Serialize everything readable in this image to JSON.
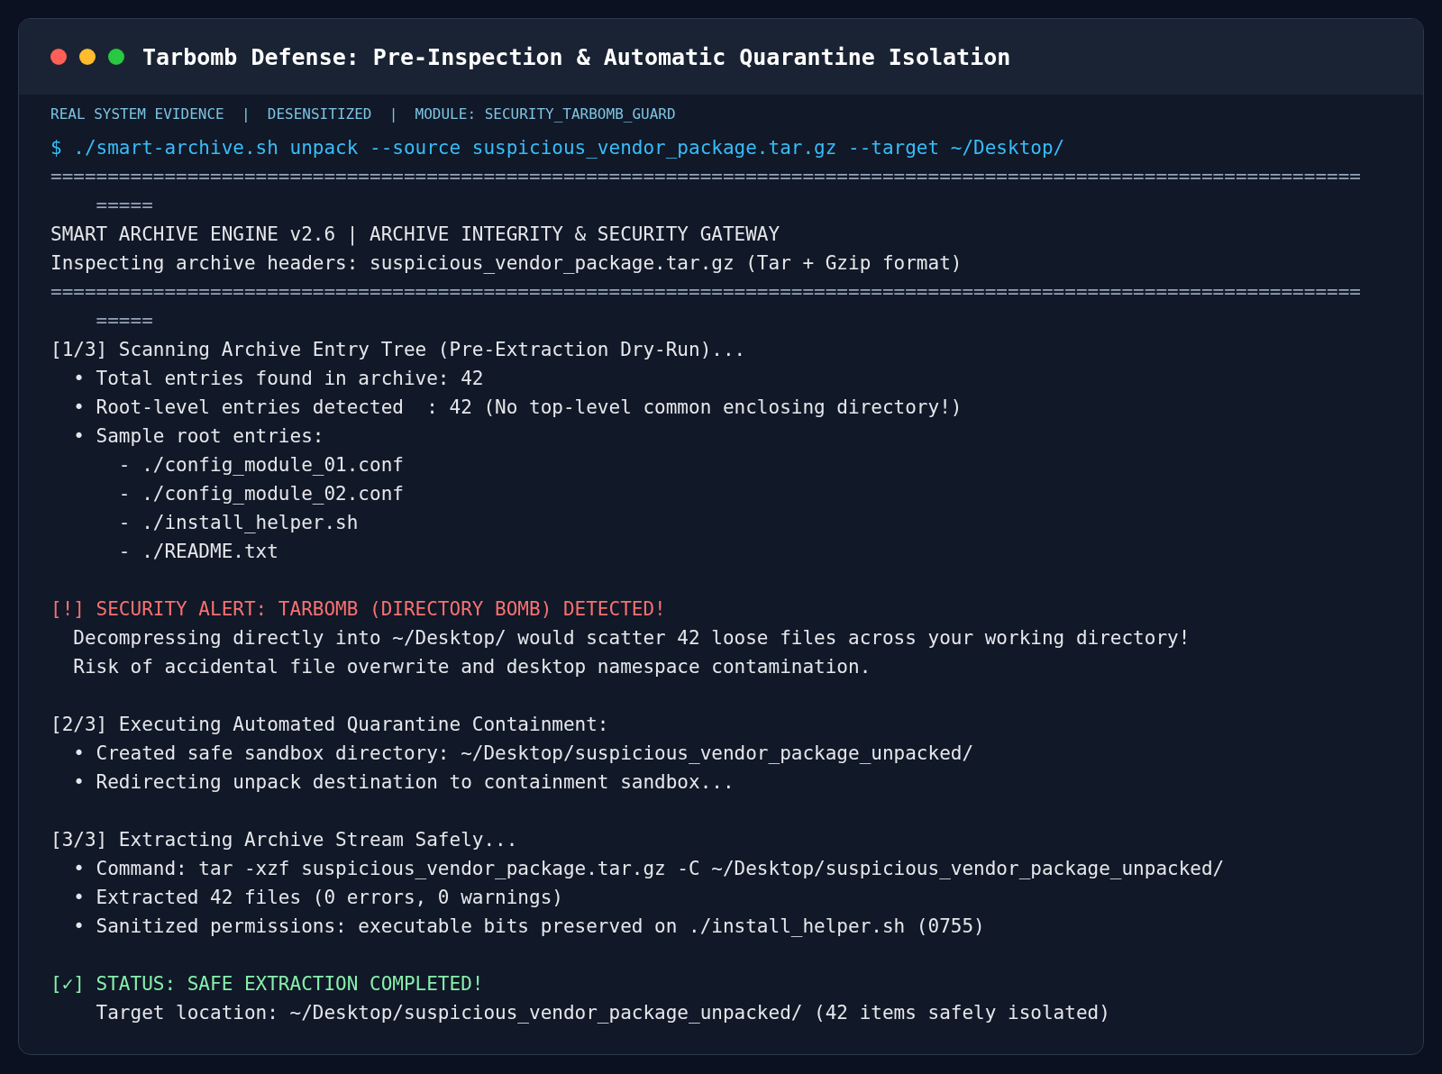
{
  "window": {
    "title": "Tarbomb Defense: Pre-Inspection & Automatic Quarantine Isolation"
  },
  "meta": "REAL SYSTEM EVIDENCE  |  DESENSITIZED  |  MODULE: SECURITY_TARBOMB_GUARD",
  "prompt": "$ ./smart-archive.sh unpack --source suspicious_vendor_package.tar.gz --target ~/Desktop/",
  "lines": [
    {
      "kind": "rule",
      "text": "==================================================================================================================="
    },
    {
      "kind": "rule",
      "text": "    ====="
    },
    {
      "kind": "plain",
      "text": "SMART ARCHIVE ENGINE v2.6 | ARCHIVE INTEGRITY & SECURITY GATEWAY"
    },
    {
      "kind": "plain",
      "text": "Inspecting archive headers: suspicious_vendor_package.tar.gz (Tar + Gzip format)"
    },
    {
      "kind": "rule",
      "text": "==================================================================================================================="
    },
    {
      "kind": "rule",
      "text": "    ====="
    },
    {
      "kind": "plain",
      "text": "[1/3] Scanning Archive Entry Tree (Pre-Extraction Dry-Run)..."
    },
    {
      "kind": "plain",
      "text": "  • Total entries found in archive: 42"
    },
    {
      "kind": "plain",
      "text": "  • Root-level entries detected  : 42 (No top-level common enclosing directory!)"
    },
    {
      "kind": "plain",
      "text": "  • Sample root entries:"
    },
    {
      "kind": "plain",
      "text": "      - ./config_module_01.conf"
    },
    {
      "kind": "plain",
      "text": "      - ./config_module_02.conf"
    },
    {
      "kind": "plain",
      "text": "      - ./install_helper.sh"
    },
    {
      "kind": "plain",
      "text": "      - ./README.txt"
    },
    {
      "kind": "blank"
    },
    {
      "kind": "alert",
      "text": "[!] SECURITY ALERT: TARBOMB (DIRECTORY BOMB) DETECTED!"
    },
    {
      "kind": "plain",
      "text": "  Decompressing directly into ~/Desktop/ would scatter 42 loose files across your working directory!"
    },
    {
      "kind": "plain",
      "text": "  Risk of accidental file overwrite and desktop namespace contamination."
    },
    {
      "kind": "blank"
    },
    {
      "kind": "plain",
      "text": "[2/3] Executing Automated Quarantine Containment:"
    },
    {
      "kind": "plain",
      "text": "  • Created safe sandbox directory: ~/Desktop/suspicious_vendor_package_unpacked/"
    },
    {
      "kind": "plain",
      "text": "  • Redirecting unpack destination to containment sandbox..."
    },
    {
      "kind": "blank"
    },
    {
      "kind": "plain",
      "text": "[3/3] Extracting Archive Stream Safely..."
    },
    {
      "kind": "plain",
      "text": "  • Command: tar -xzf suspicious_vendor_package.tar.gz -C ~/Desktop/suspicious_vendor_package_unpacked/"
    },
    {
      "kind": "plain",
      "text": "  • Extracted 42 files (0 errors, 0 warnings)"
    },
    {
      "kind": "plain",
      "text": "  • Sanitized permissions: executable bits preserved on ./install_helper.sh (0755)"
    },
    {
      "kind": "blank"
    },
    {
      "kind": "success",
      "text": "[✓] STATUS: SAFE EXTRACTION COMPLETED!"
    },
    {
      "kind": "plain",
      "text": "    Target location: ~/Desktop/suspicious_vendor_package_unpacked/ (42 items safely isolated)"
    }
  ]
}
